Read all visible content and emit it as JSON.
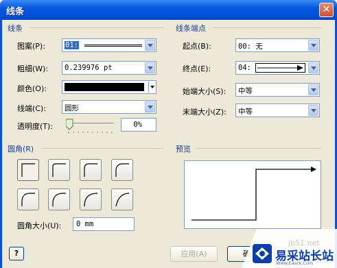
{
  "window": {
    "title": "线条",
    "close_glyph": "✕"
  },
  "line_section": {
    "heading": "线条",
    "pattern": {
      "label": "图案(P):",
      "value": "01:"
    },
    "weight": {
      "label": "粗细(W):",
      "value": "0.239976 pt"
    },
    "color": {
      "label": "颜色(O):",
      "value": "#000000"
    },
    "cap": {
      "label": "线端(C):",
      "value": "圆形"
    },
    "transparency": {
      "label": "透明度(T):",
      "value": "0%",
      "level": 0
    }
  },
  "ends_section": {
    "heading": "线条端点",
    "begin": {
      "label": "起点(B):",
      "value": "00: 无"
    },
    "end": {
      "label": "终点(E):",
      "value": "04:"
    },
    "begin_size": {
      "label": "始端大小(S):",
      "value": "中等"
    },
    "end_size": {
      "label": "末端大小(Z):",
      "value": "中等"
    }
  },
  "rounding_section": {
    "heading": "圆角(R)",
    "size": {
      "label": "圆角大小(U):",
      "value": "0 mm"
    }
  },
  "preview_section": {
    "heading": "预览"
  },
  "buttons": {
    "help": "?",
    "apply": "应用(A)",
    "ok": "确"
  },
  "watermark": {
    "url": "jb51.net",
    "text": "易采站长站",
    "sub": "Www.Easck.Com"
  },
  "colors": {
    "title": "#0a4fd6",
    "client": "#ece9d8",
    "section": "#1f3d9e",
    "watermark": "#0b3fa8"
  }
}
